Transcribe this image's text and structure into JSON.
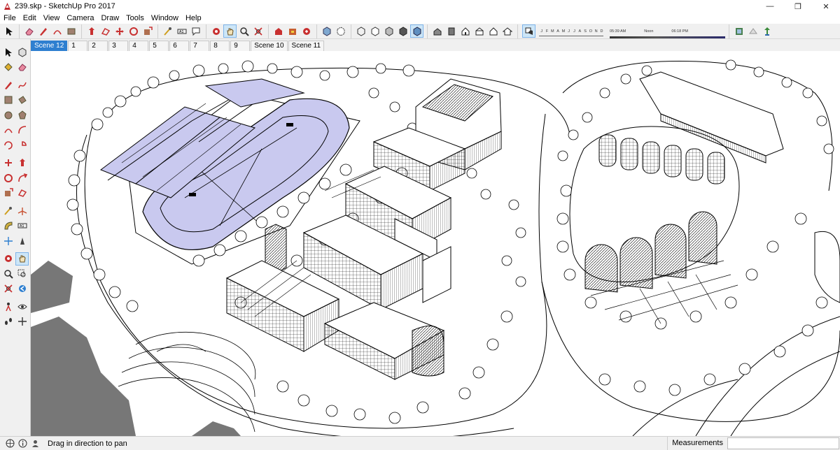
{
  "window": {
    "title": "239.skp - SketchUp Pro 2017",
    "minimize": "—",
    "maximize": "❐",
    "close": "✕"
  },
  "menu": [
    "File",
    "Edit",
    "View",
    "Camera",
    "Draw",
    "Tools",
    "Window",
    "Help"
  ],
  "shadows": {
    "months": [
      "J",
      "F",
      "M",
      "A",
      "M",
      "J",
      "J",
      "A",
      "S",
      "O",
      "N",
      "D"
    ],
    "time_start": "05:39 AM",
    "time_mid": "Noon",
    "time_end": "06:18 PM"
  },
  "scenes": [
    "Scene 12",
    "1",
    "2",
    "3",
    "4",
    "5",
    "6",
    "7",
    "8",
    "9",
    "Scene 10",
    "Scene 11"
  ],
  "active_scene": "Scene 12",
  "status": {
    "hint": "Drag in direction to pan",
    "measurements_label": "Measurements",
    "measurements_value": ""
  },
  "colors": {
    "accent": "#2e7fd0",
    "field": "#c9c9ef",
    "ink": "#000000",
    "terrain": "#777777"
  }
}
